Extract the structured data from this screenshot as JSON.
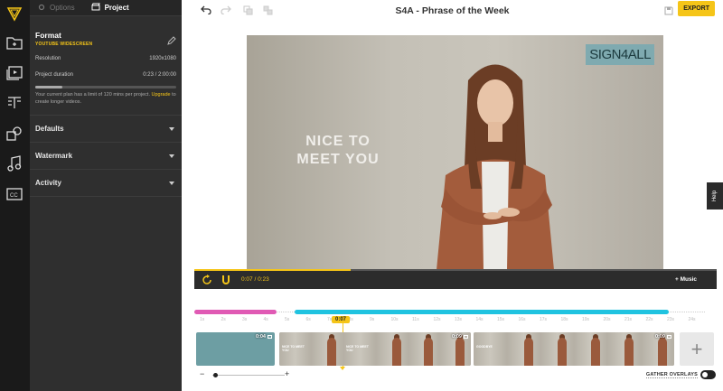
{
  "panel": {
    "tabs": [
      {
        "label": "Options"
      },
      {
        "label": "Project"
      }
    ],
    "format": {
      "title": "Format",
      "subtitle": "YOUTUBE WIDESCREEN"
    },
    "resolution": {
      "label": "Resolution",
      "value": "1920x1080"
    },
    "duration": {
      "label": "Project duration",
      "value": "0:23 / 2:00:00",
      "fraction": 0.19
    },
    "note": {
      "text": "Your current plan has a limit of 120 mins per project.",
      "link": "Upgrade",
      "tail": "to create longer videos."
    },
    "sections": [
      {
        "label": "Defaults"
      },
      {
        "label": "Watermark"
      },
      {
        "label": "Activity"
      }
    ]
  },
  "topbar": {
    "title": "S4A - Phrase of the Week",
    "export_label": "EXPORT"
  },
  "video": {
    "logo_text": "SIGN4ALL",
    "overlay_line1": "NICE TO",
    "overlay_line2": "MEET YOU"
  },
  "help_label": "Help",
  "player": {
    "current_time": "0:07",
    "separator": "/",
    "total_time": "0:23",
    "music_label": "+ Music",
    "progress": 0.3
  },
  "timeline": {
    "playhead_label": "0:07",
    "ticks": [
      "1s",
      "2s",
      "3s",
      "4s",
      "5s",
      "6s",
      "7s",
      "8s",
      "9s",
      "10s",
      "11s",
      "12s",
      "13s",
      "14s",
      "15s",
      "16s",
      "17s",
      "18s",
      "19s",
      "20s",
      "21s",
      "22s",
      "23s",
      "24s"
    ],
    "clips": [
      {
        "duration": "0:04"
      },
      {
        "duration": "0:09"
      },
      {
        "duration": "0:09"
      }
    ],
    "frame_labels": [
      "NICE TO MEET YOU",
      "NICE TO MEET YOU",
      "GOODBYE"
    ],
    "add_label": "+",
    "zoom_minus": "−",
    "zoom_plus": "+",
    "gather_label": "GATHER OVERLAYS"
  },
  "colors": {
    "accent": "#f5c518",
    "panel_bg": "#2f2f2f",
    "rail_bg": "#1a1a1a",
    "overlay_pink": "#e05ab4",
    "overlay_cyan": "#20c3e0"
  }
}
